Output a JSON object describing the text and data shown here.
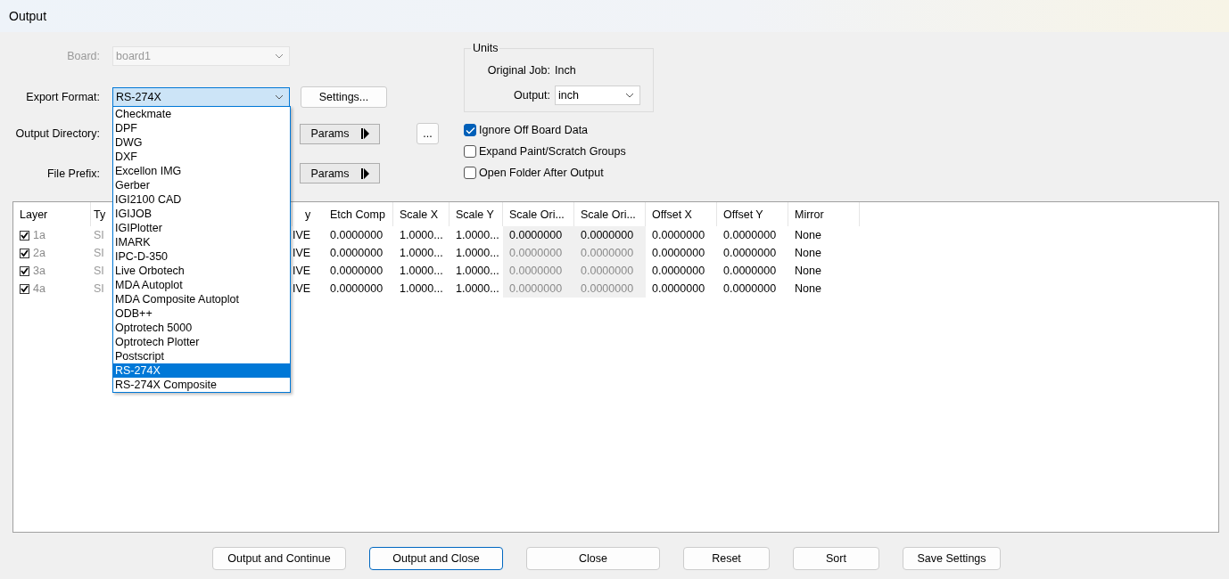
{
  "window": {
    "title": "Output"
  },
  "board": {
    "label": "Board:",
    "value": "board1",
    "disabled": true
  },
  "export_format": {
    "label": "Export Format:",
    "value": "RS-274X",
    "expanded": true,
    "options": [
      {
        "label": "Checkmate",
        "selected": false
      },
      {
        "label": "DPF",
        "selected": false
      },
      {
        "label": "DWG",
        "selected": false
      },
      {
        "label": "DXF",
        "selected": false
      },
      {
        "label": "Excellon IMG",
        "selected": false
      },
      {
        "label": "Gerber",
        "selected": false
      },
      {
        "label": "IGI2100 CAD",
        "selected": false
      },
      {
        "label": "IGIJOB",
        "selected": false
      },
      {
        "label": "IGIPlotter",
        "selected": false
      },
      {
        "label": "IMARK",
        "selected": false
      },
      {
        "label": "IPC-D-350",
        "selected": false
      },
      {
        "label": "Live Orbotech",
        "selected": false
      },
      {
        "label": "MDA Autoplot",
        "selected": false
      },
      {
        "label": "MDA Composite Autoplot",
        "selected": false
      },
      {
        "label": "ODB++",
        "selected": false
      },
      {
        "label": "Optrotech 5000",
        "selected": false
      },
      {
        "label": "Optrotech Plotter",
        "selected": false
      },
      {
        "label": "Postscript",
        "selected": false
      },
      {
        "label": "RS-274X",
        "selected": true
      },
      {
        "label": "RS-274X Composite",
        "selected": false
      }
    ]
  },
  "settings_button": "Settings...",
  "output_directory": {
    "label": "Output Directory:",
    "params_button": "Params",
    "browse_button": "..."
  },
  "file_prefix": {
    "label": "File Prefix:",
    "params_button": "Params"
  },
  "units": {
    "title": "Units",
    "original_job_label": "Original Job:",
    "original_job_value": "Inch",
    "output_label": "Output:",
    "output_value": "inch"
  },
  "options": [
    {
      "label": "Ignore Off Board Data",
      "checked": true
    },
    {
      "label": "Expand Paint/Scratch Groups",
      "checked": false
    },
    {
      "label": "Open Folder After Output",
      "checked": false
    }
  ],
  "table": {
    "columns": [
      "Layer",
      "Ty",
      "y",
      "Etch Comp",
      "Scale X",
      "Scale Y",
      "Scale Ori...",
      "Scale Ori...",
      "Offset X",
      "Offset Y",
      "Mirror"
    ],
    "rows": [
      {
        "checked": true,
        "scale_origin_disabled": false,
        "cells": [
          "1a",
          "SI",
          "IVE",
          "0.0000000",
          "1.0000...",
          "1.0000...",
          "0.0000000",
          "0.0000000",
          "0.0000000",
          "0.0000000",
          "None"
        ]
      },
      {
        "checked": true,
        "scale_origin_disabled": true,
        "cells": [
          "2a",
          "SI",
          "IVE",
          "0.0000000",
          "1.0000...",
          "1.0000...",
          "0.0000000",
          "0.0000000",
          "0.0000000",
          "0.0000000",
          "None"
        ]
      },
      {
        "checked": true,
        "scale_origin_disabled": true,
        "cells": [
          "3a",
          "SI",
          "IVE",
          "0.0000000",
          "1.0000...",
          "1.0000...",
          "0.0000000",
          "0.0000000",
          "0.0000000",
          "0.0000000",
          "None"
        ]
      },
      {
        "checked": true,
        "scale_origin_disabled": true,
        "cells": [
          "4a",
          "SI",
          "IVE",
          "0.0000000",
          "1.0000...",
          "1.0000...",
          "0.0000000",
          "0.0000000",
          "0.0000000",
          "0.0000000",
          "None"
        ]
      }
    ]
  },
  "buttons": [
    {
      "label": "Output and Continue",
      "selected": false
    },
    {
      "label": "Output and Close",
      "selected": true
    },
    {
      "label": "Close",
      "selected": false
    },
    {
      "label": "Reset",
      "selected": false
    },
    {
      "label": "Sort",
      "selected": false
    },
    {
      "label": "Save Settings",
      "selected": false
    }
  ]
}
